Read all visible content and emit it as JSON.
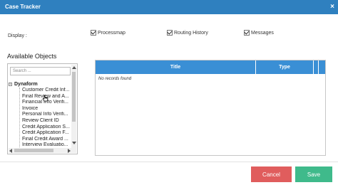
{
  "window": {
    "title": "Case Tracker",
    "close_glyph": "×"
  },
  "display": {
    "label": "Display :",
    "options": [
      {
        "label": "Processmap",
        "checked": true
      },
      {
        "label": "Routing History",
        "checked": true
      },
      {
        "label": "Messages",
        "checked": true
      }
    ]
  },
  "objects": {
    "heading": "Available Objects",
    "search_placeholder": "Search ...",
    "root": {
      "expander": "-",
      "label": "Dynaform"
    },
    "items": [
      "Customer Credit Inf...",
      "Final Review and A...",
      "Financial Info Verifi...",
      "Invoice",
      "Personal Info Verifi...",
      "Review Client ID",
      "Credit Application S...",
      "Credit Application F...",
      "Final Credit Award ...",
      "Interview Evaluatio..."
    ]
  },
  "grid": {
    "columns": [
      "Title",
      "Type"
    ],
    "empty_text": "No records found"
  },
  "footer": {
    "cancel_label": "Cancel",
    "save_label": "Save"
  },
  "colors": {
    "titlebar": "#2f80bf",
    "grid_header": "#3a8fd5",
    "cancel": "#e05d5d",
    "save": "#3fba8b"
  }
}
